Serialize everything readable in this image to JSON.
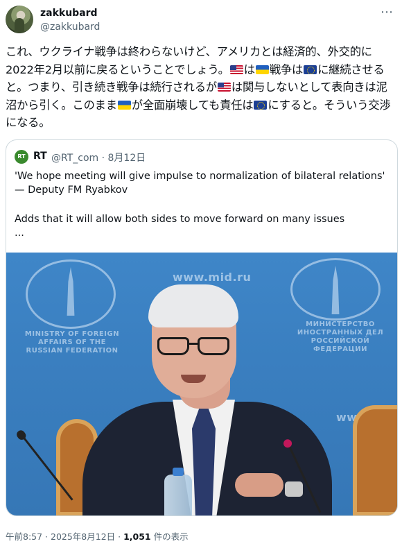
{
  "author": {
    "name": "zakkubard",
    "handle": "@zakkubard",
    "avatar_icon": "avatar-image"
  },
  "more_icon": "more-options-icon",
  "tweet": {
    "segments": [
      "これ、ウクライナ戦争は終わらないけど、アメリカとは経済的、外交的に2022年2月以前に戻るということでしょう。",
      "は",
      "戦争は",
      "に継続させると。つまり、引き続き戦争は続行されるが",
      "は関与しないとして表向きは泥沼から引く。このまま",
      "が全面崩壊しても責任は",
      "にすると。そういう交渉になる。"
    ],
    "flags": {
      "us": "flag-us",
      "ukraine": "flag-ukraine",
      "eu": "flag-eu"
    }
  },
  "quoted": {
    "logo_text": "RT",
    "name": "RT",
    "handle_date": "@RT_com · 8月12日",
    "line1": "'We hope meeting will give impulse to normalization of bilateral relations' — Deputy FM Ryabkov",
    "line2": "Adds that it will allow both sides to move forward on many issues",
    "ellipsis": "...",
    "image": {
      "watermark_left": "MINISTRY OF FOREIGN AFFAIRS OF THE RUSSIAN FEDERATION",
      "watermark_right": "МИНИСТЕРСТВО ИНОСТРАННЫХ ДЕЛ РОССИЙСКОЙ ФЕДЕРАЦИИ",
      "site_top": "www.mid.ru",
      "site_right": "www.mid."
    }
  },
  "meta": {
    "time_date": "午前8:57 · 2025年8月12日 · ",
    "views_count": "1,051",
    "views_label": " 件の表示"
  }
}
